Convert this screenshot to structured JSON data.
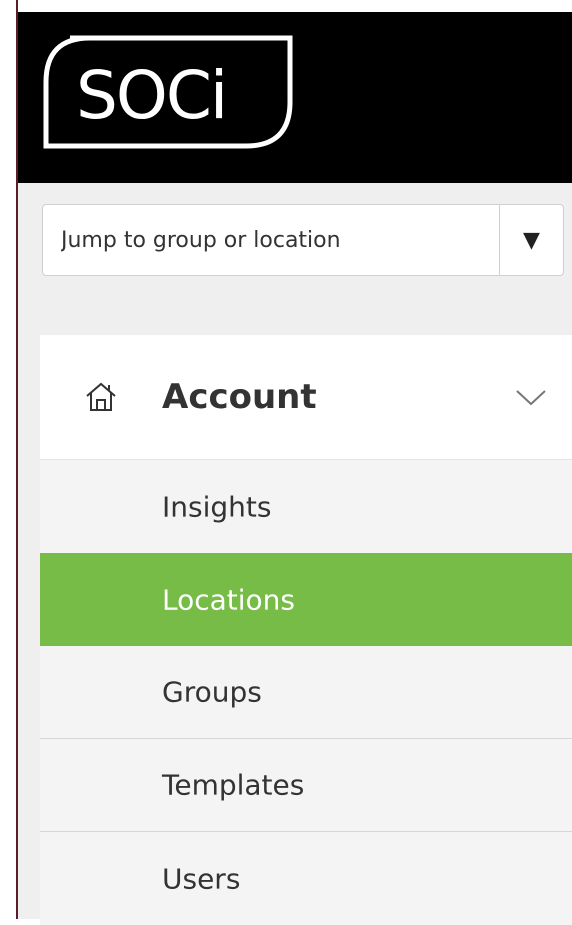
{
  "logo": {
    "text": "SOCi"
  },
  "jump": {
    "placeholder": "Jump to group or location",
    "toggle_symbol": "▼"
  },
  "nav": {
    "section_title": "Account",
    "section_icon": "home-icon",
    "section_toggle_icon": "chevron-down-icon",
    "items": [
      {
        "label": "Insights",
        "active": false
      },
      {
        "label": "Locations",
        "active": true
      },
      {
        "label": "Groups",
        "active": false
      },
      {
        "label": "Templates",
        "active": false
      },
      {
        "label": "Users",
        "active": false
      }
    ]
  },
  "colors": {
    "topbar": "#000000",
    "active_item": "#76bc47"
  }
}
